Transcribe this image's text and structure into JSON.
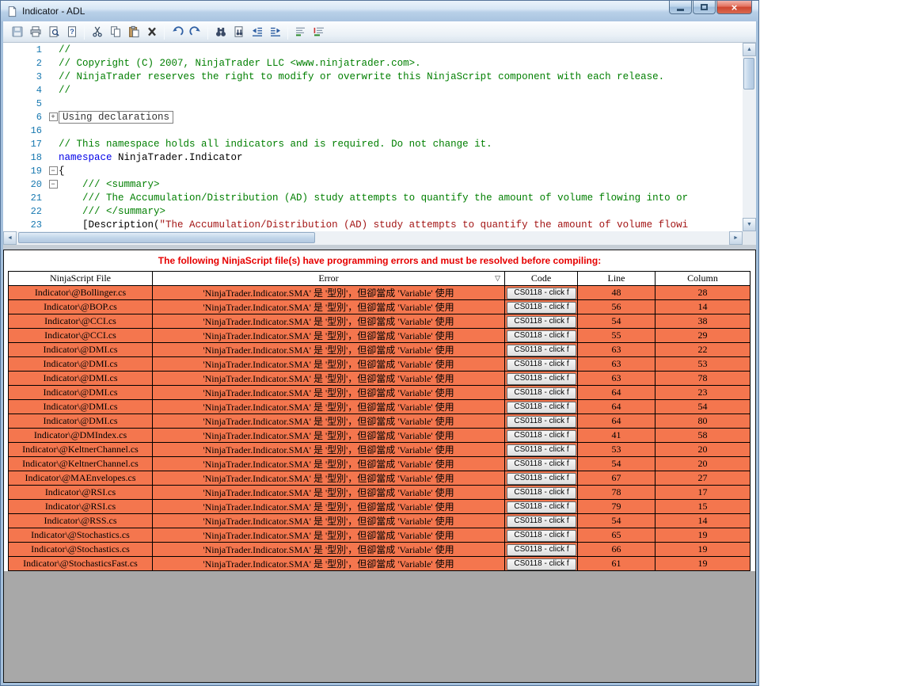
{
  "window": {
    "title": "Indicator - ADL"
  },
  "icons": {
    "up": "▲",
    "down": "▼",
    "left": "◄",
    "right": "►",
    "sort": "▽",
    "close": "×"
  },
  "colors": {
    "row_bg": "#F4764E",
    "error_text": "#E60000",
    "comment": "#007F00",
    "keyword": "#0000E8",
    "string": "#A31515",
    "line_number": "#1778B0"
  },
  "toolbar": {
    "items": [
      "save",
      "print",
      "print-preview",
      "properties",
      "|",
      "cut",
      "copy",
      "paste",
      "delete",
      "|",
      "undo",
      "redo",
      "|",
      "find",
      "replace",
      "outdent",
      "indent",
      "|",
      "comment-selection",
      "uncomment-selection"
    ]
  },
  "editor": {
    "lines": [
      {
        "n": "1",
        "fold": "",
        "segs": [
          [
            "comment",
            "//"
          ]
        ]
      },
      {
        "n": "2",
        "fold": "",
        "segs": [
          [
            "comment",
            "// Copyright (C) 2007, NinjaTrader LLC <www.ninjatrader.com>."
          ]
        ]
      },
      {
        "n": "3",
        "fold": "",
        "segs": [
          [
            "comment",
            "// NinjaTrader reserves the right to modify or overwrite this NinjaScript component with each release."
          ]
        ]
      },
      {
        "n": "4",
        "fold": "",
        "segs": [
          [
            "comment",
            "//"
          ]
        ]
      },
      {
        "n": "5",
        "fold": "",
        "segs": []
      },
      {
        "n": "6",
        "fold": "+",
        "box": "Using declarations",
        "segs": []
      },
      {
        "n": "16",
        "fold": "",
        "segs": []
      },
      {
        "n": "17",
        "fold": "",
        "segs": [
          [
            "comment",
            "// This namespace holds all indicators and is required. Do not change it."
          ]
        ]
      },
      {
        "n": "18",
        "fold": "",
        "segs": [
          [
            "keyword",
            "namespace"
          ],
          [
            "plain",
            " NinjaTrader.Indicator"
          ]
        ]
      },
      {
        "n": "19",
        "fold": "-",
        "segs": [
          [
            "plain",
            "{"
          ]
        ]
      },
      {
        "n": "20",
        "fold": "-",
        "segs": [
          [
            "comment",
            "    /// <summary>"
          ]
        ]
      },
      {
        "n": "21",
        "fold": "",
        "segs": [
          [
            "comment",
            "    /// The Accumulation/Distribution (AD) study attempts to quantify the amount of volume flowing into or"
          ]
        ]
      },
      {
        "n": "22",
        "fold": "",
        "segs": [
          [
            "comment",
            "    /// </summary>"
          ]
        ]
      },
      {
        "n": "23",
        "fold": "",
        "segs": [
          [
            "plain",
            "    [Description("
          ],
          [
            "string",
            "\"The Accumulation/Distribution (AD) study attempts to quantify the amount of volume flowi"
          ]
        ]
      }
    ]
  },
  "errors": {
    "message": "The following NinjaScript file(s) have programming errors and must be resolved before compiling:",
    "columns": [
      "NinjaScript File",
      "Error",
      "Code",
      "Line",
      "Column"
    ],
    "rows": [
      {
        "file": "Indicator\\@Bollinger.cs",
        "error": "'NinjaTrader.Indicator.SMA' 是 '型別'，但卻當成 'Variable' 使用",
        "code": "CS0118 - click f",
        "line": "48",
        "column": "28"
      },
      {
        "file": "Indicator\\@BOP.cs",
        "error": "'NinjaTrader.Indicator.SMA' 是 '型別'，但卻當成 'Variable' 使用",
        "code": "CS0118 - click f",
        "line": "56",
        "column": "14"
      },
      {
        "file": "Indicator\\@CCI.cs",
        "error": "'NinjaTrader.Indicator.SMA' 是 '型別'，但卻當成 'Variable' 使用",
        "code": "CS0118 - click f",
        "line": "54",
        "column": "38"
      },
      {
        "file": "Indicator\\@CCI.cs",
        "error": "'NinjaTrader.Indicator.SMA' 是 '型別'，但卻當成 'Variable' 使用",
        "code": "CS0118 - click f",
        "line": "55",
        "column": "29"
      },
      {
        "file": "Indicator\\@DMI.cs",
        "error": "'NinjaTrader.Indicator.SMA' 是 '型別'，但卻當成 'Variable' 使用",
        "code": "CS0118 - click f",
        "line": "63",
        "column": "22"
      },
      {
        "file": "Indicator\\@DMI.cs",
        "error": "'NinjaTrader.Indicator.SMA' 是 '型別'，但卻當成 'Variable' 使用",
        "code": "CS0118 - click f",
        "line": "63",
        "column": "53"
      },
      {
        "file": "Indicator\\@DMI.cs",
        "error": "'NinjaTrader.Indicator.SMA' 是 '型別'，但卻當成 'Variable' 使用",
        "code": "CS0118 - click f",
        "line": "63",
        "column": "78"
      },
      {
        "file": "Indicator\\@DMI.cs",
        "error": "'NinjaTrader.Indicator.SMA' 是 '型別'，但卻當成 'Variable' 使用",
        "code": "CS0118 - click f",
        "line": "64",
        "column": "23"
      },
      {
        "file": "Indicator\\@DMI.cs",
        "error": "'NinjaTrader.Indicator.SMA' 是 '型別'，但卻當成 'Variable' 使用",
        "code": "CS0118 - click f",
        "line": "64",
        "column": "54"
      },
      {
        "file": "Indicator\\@DMI.cs",
        "error": "'NinjaTrader.Indicator.SMA' 是 '型別'，但卻當成 'Variable' 使用",
        "code": "CS0118 - click f",
        "line": "64",
        "column": "80"
      },
      {
        "file": "Indicator\\@DMIndex.cs",
        "error": "'NinjaTrader.Indicator.SMA' 是 '型別'，但卻當成 'Variable' 使用",
        "code": "CS0118 - click f",
        "line": "41",
        "column": "58"
      },
      {
        "file": "Indicator\\@KeltnerChannel.cs",
        "error": "'NinjaTrader.Indicator.SMA' 是 '型別'，但卻當成 'Variable' 使用",
        "code": "CS0118 - click f",
        "line": "53",
        "column": "20"
      },
      {
        "file": "Indicator\\@KeltnerChannel.cs",
        "error": "'NinjaTrader.Indicator.SMA' 是 '型別'，但卻當成 'Variable' 使用",
        "code": "CS0118 - click f",
        "line": "54",
        "column": "20"
      },
      {
        "file": "Indicator\\@MAEnvelopes.cs",
        "error": "'NinjaTrader.Indicator.SMA' 是 '型別'，但卻當成 'Variable' 使用",
        "code": "CS0118 - click f",
        "line": "67",
        "column": "27"
      },
      {
        "file": "Indicator\\@RSI.cs",
        "error": "'NinjaTrader.Indicator.SMA' 是 '型別'，但卻當成 'Variable' 使用",
        "code": "CS0118 - click f",
        "line": "78",
        "column": "17"
      },
      {
        "file": "Indicator\\@RSI.cs",
        "error": "'NinjaTrader.Indicator.SMA' 是 '型別'，但卻當成 'Variable' 使用",
        "code": "CS0118 - click f",
        "line": "79",
        "column": "15"
      },
      {
        "file": "Indicator\\@RSS.cs",
        "error": "'NinjaTrader.Indicator.SMA' 是 '型別'，但卻當成 'Variable' 使用",
        "code": "CS0118 - click f",
        "line": "54",
        "column": "14"
      },
      {
        "file": "Indicator\\@Stochastics.cs",
        "error": "'NinjaTrader.Indicator.SMA' 是 '型別'，但卻當成 'Variable' 使用",
        "code": "CS0118 - click f",
        "line": "65",
        "column": "19"
      },
      {
        "file": "Indicator\\@Stochastics.cs",
        "error": "'NinjaTrader.Indicator.SMA' 是 '型別'，但卻當成 'Variable' 使用",
        "code": "CS0118 - click f",
        "line": "66",
        "column": "19"
      },
      {
        "file": "Indicator\\@StochasticsFast.cs",
        "error": "'NinjaTrader.Indicator.SMA' 是 '型別'，但卻當成 'Variable' 使用",
        "code": "CS0118 - click f",
        "line": "61",
        "column": "19"
      }
    ]
  }
}
